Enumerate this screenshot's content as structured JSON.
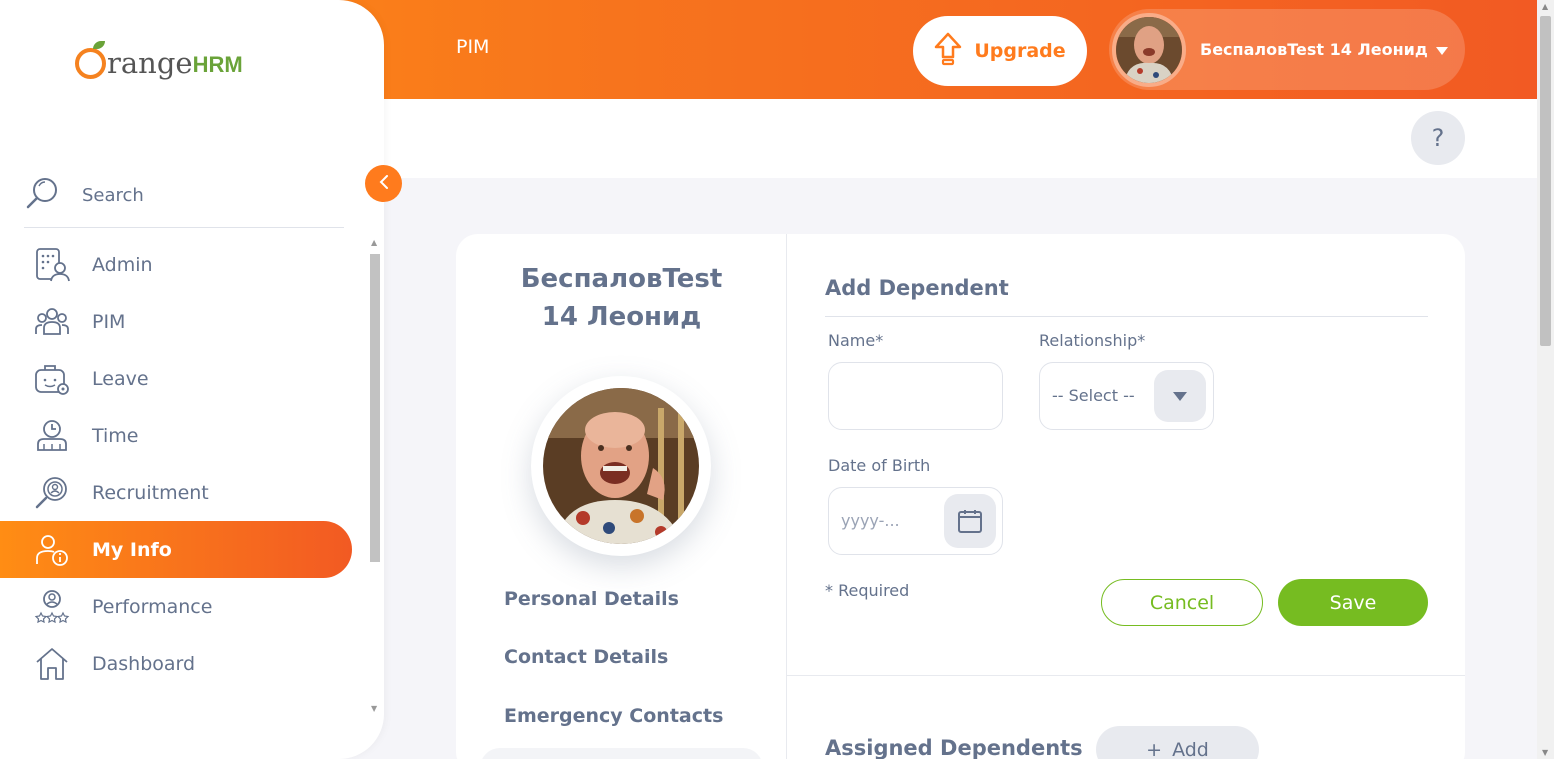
{
  "header": {
    "module_title": "PIM",
    "upgrade_label": "Upgrade",
    "user_name": "БеспаловTest 14 Леонид",
    "help_label": "?"
  },
  "sidebar": {
    "brand_main": "range",
    "brand_suffix": "HRM",
    "search_label": "Search",
    "items": [
      {
        "label": "Admin",
        "icon": "admin-icon"
      },
      {
        "label": "PIM",
        "icon": "pim-icon"
      },
      {
        "label": "Leave",
        "icon": "leave-icon"
      },
      {
        "label": "Time",
        "icon": "time-icon"
      },
      {
        "label": "Recruitment",
        "icon": "recruitment-icon"
      },
      {
        "label": "My Info",
        "icon": "my-info-icon",
        "active": true
      },
      {
        "label": "Performance",
        "icon": "performance-icon"
      },
      {
        "label": "Dashboard",
        "icon": "dashboard-icon"
      }
    ]
  },
  "employee": {
    "name_line1": "БеспаловTest",
    "name_line2": "14 Леонид"
  },
  "tabs": [
    {
      "label": "Personal Details"
    },
    {
      "label": "Contact Details"
    },
    {
      "label": "Emergency Contacts"
    }
  ],
  "add_dependent": {
    "title": "Add Dependent",
    "name_label": "Name*",
    "name_value": "",
    "relationship_label": "Relationship*",
    "relationship_value": "-- Select --",
    "dob_label": "Date of Birth",
    "dob_placeholder": "yyyy-...",
    "required_note": "* Required",
    "cancel_label": "Cancel",
    "save_label": "Save"
  },
  "assigned_dependents": {
    "title": "Assigned Dependents",
    "add_label": "Add",
    "add_prefix": "+"
  },
  "colors": {
    "accent": "#ff7b1d",
    "gradient_start": "#ff8d14",
    "gradient_end": "#f25a23",
    "save_green": "#76bc21",
    "text": "#64728c"
  }
}
